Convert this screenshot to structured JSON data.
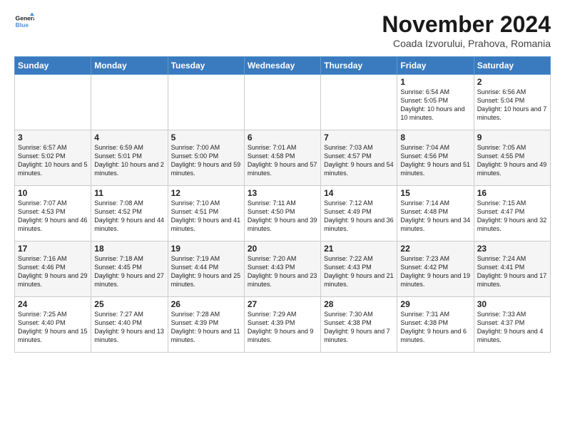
{
  "logo": {
    "line1": "General",
    "line2": "Blue"
  },
  "title": "November 2024",
  "location": "Coada Izvorului, Prahova, Romania",
  "headers": [
    "Sunday",
    "Monday",
    "Tuesday",
    "Wednesday",
    "Thursday",
    "Friday",
    "Saturday"
  ],
  "weeks": [
    [
      {
        "day": "",
        "info": ""
      },
      {
        "day": "",
        "info": ""
      },
      {
        "day": "",
        "info": ""
      },
      {
        "day": "",
        "info": ""
      },
      {
        "day": "",
        "info": ""
      },
      {
        "day": "1",
        "info": "Sunrise: 6:54 AM\nSunset: 5:05 PM\nDaylight: 10 hours\nand 10 minutes."
      },
      {
        "day": "2",
        "info": "Sunrise: 6:56 AM\nSunset: 5:04 PM\nDaylight: 10 hours\nand 7 minutes."
      }
    ],
    [
      {
        "day": "3",
        "info": "Sunrise: 6:57 AM\nSunset: 5:02 PM\nDaylight: 10 hours\nand 5 minutes."
      },
      {
        "day": "4",
        "info": "Sunrise: 6:59 AM\nSunset: 5:01 PM\nDaylight: 10 hours\nand 2 minutes."
      },
      {
        "day": "5",
        "info": "Sunrise: 7:00 AM\nSunset: 5:00 PM\nDaylight: 9 hours\nand 59 minutes."
      },
      {
        "day": "6",
        "info": "Sunrise: 7:01 AM\nSunset: 4:58 PM\nDaylight: 9 hours\nand 57 minutes."
      },
      {
        "day": "7",
        "info": "Sunrise: 7:03 AM\nSunset: 4:57 PM\nDaylight: 9 hours\nand 54 minutes."
      },
      {
        "day": "8",
        "info": "Sunrise: 7:04 AM\nSunset: 4:56 PM\nDaylight: 9 hours\nand 51 minutes."
      },
      {
        "day": "9",
        "info": "Sunrise: 7:05 AM\nSunset: 4:55 PM\nDaylight: 9 hours\nand 49 minutes."
      }
    ],
    [
      {
        "day": "10",
        "info": "Sunrise: 7:07 AM\nSunset: 4:53 PM\nDaylight: 9 hours\nand 46 minutes."
      },
      {
        "day": "11",
        "info": "Sunrise: 7:08 AM\nSunset: 4:52 PM\nDaylight: 9 hours\nand 44 minutes."
      },
      {
        "day": "12",
        "info": "Sunrise: 7:10 AM\nSunset: 4:51 PM\nDaylight: 9 hours\nand 41 minutes."
      },
      {
        "day": "13",
        "info": "Sunrise: 7:11 AM\nSunset: 4:50 PM\nDaylight: 9 hours\nand 39 minutes."
      },
      {
        "day": "14",
        "info": "Sunrise: 7:12 AM\nSunset: 4:49 PM\nDaylight: 9 hours\nand 36 minutes."
      },
      {
        "day": "15",
        "info": "Sunrise: 7:14 AM\nSunset: 4:48 PM\nDaylight: 9 hours\nand 34 minutes."
      },
      {
        "day": "16",
        "info": "Sunrise: 7:15 AM\nSunset: 4:47 PM\nDaylight: 9 hours\nand 32 minutes."
      }
    ],
    [
      {
        "day": "17",
        "info": "Sunrise: 7:16 AM\nSunset: 4:46 PM\nDaylight: 9 hours\nand 29 minutes."
      },
      {
        "day": "18",
        "info": "Sunrise: 7:18 AM\nSunset: 4:45 PM\nDaylight: 9 hours\nand 27 minutes."
      },
      {
        "day": "19",
        "info": "Sunrise: 7:19 AM\nSunset: 4:44 PM\nDaylight: 9 hours\nand 25 minutes."
      },
      {
        "day": "20",
        "info": "Sunrise: 7:20 AM\nSunset: 4:43 PM\nDaylight: 9 hours\nand 23 minutes."
      },
      {
        "day": "21",
        "info": "Sunrise: 7:22 AM\nSunset: 4:43 PM\nDaylight: 9 hours\nand 21 minutes."
      },
      {
        "day": "22",
        "info": "Sunrise: 7:23 AM\nSunset: 4:42 PM\nDaylight: 9 hours\nand 19 minutes."
      },
      {
        "day": "23",
        "info": "Sunrise: 7:24 AM\nSunset: 4:41 PM\nDaylight: 9 hours\nand 17 minutes."
      }
    ],
    [
      {
        "day": "24",
        "info": "Sunrise: 7:25 AM\nSunset: 4:40 PM\nDaylight: 9 hours\nand 15 minutes."
      },
      {
        "day": "25",
        "info": "Sunrise: 7:27 AM\nSunset: 4:40 PM\nDaylight: 9 hours\nand 13 minutes."
      },
      {
        "day": "26",
        "info": "Sunrise: 7:28 AM\nSunset: 4:39 PM\nDaylight: 9 hours\nand 11 minutes."
      },
      {
        "day": "27",
        "info": "Sunrise: 7:29 AM\nSunset: 4:39 PM\nDaylight: 9 hours\nand 9 minutes."
      },
      {
        "day": "28",
        "info": "Sunrise: 7:30 AM\nSunset: 4:38 PM\nDaylight: 9 hours\nand 7 minutes."
      },
      {
        "day": "29",
        "info": "Sunrise: 7:31 AM\nSunset: 4:38 PM\nDaylight: 9 hours\nand 6 minutes."
      },
      {
        "day": "30",
        "info": "Sunrise: 7:33 AM\nSunset: 4:37 PM\nDaylight: 9 hours\nand 4 minutes."
      }
    ]
  ]
}
